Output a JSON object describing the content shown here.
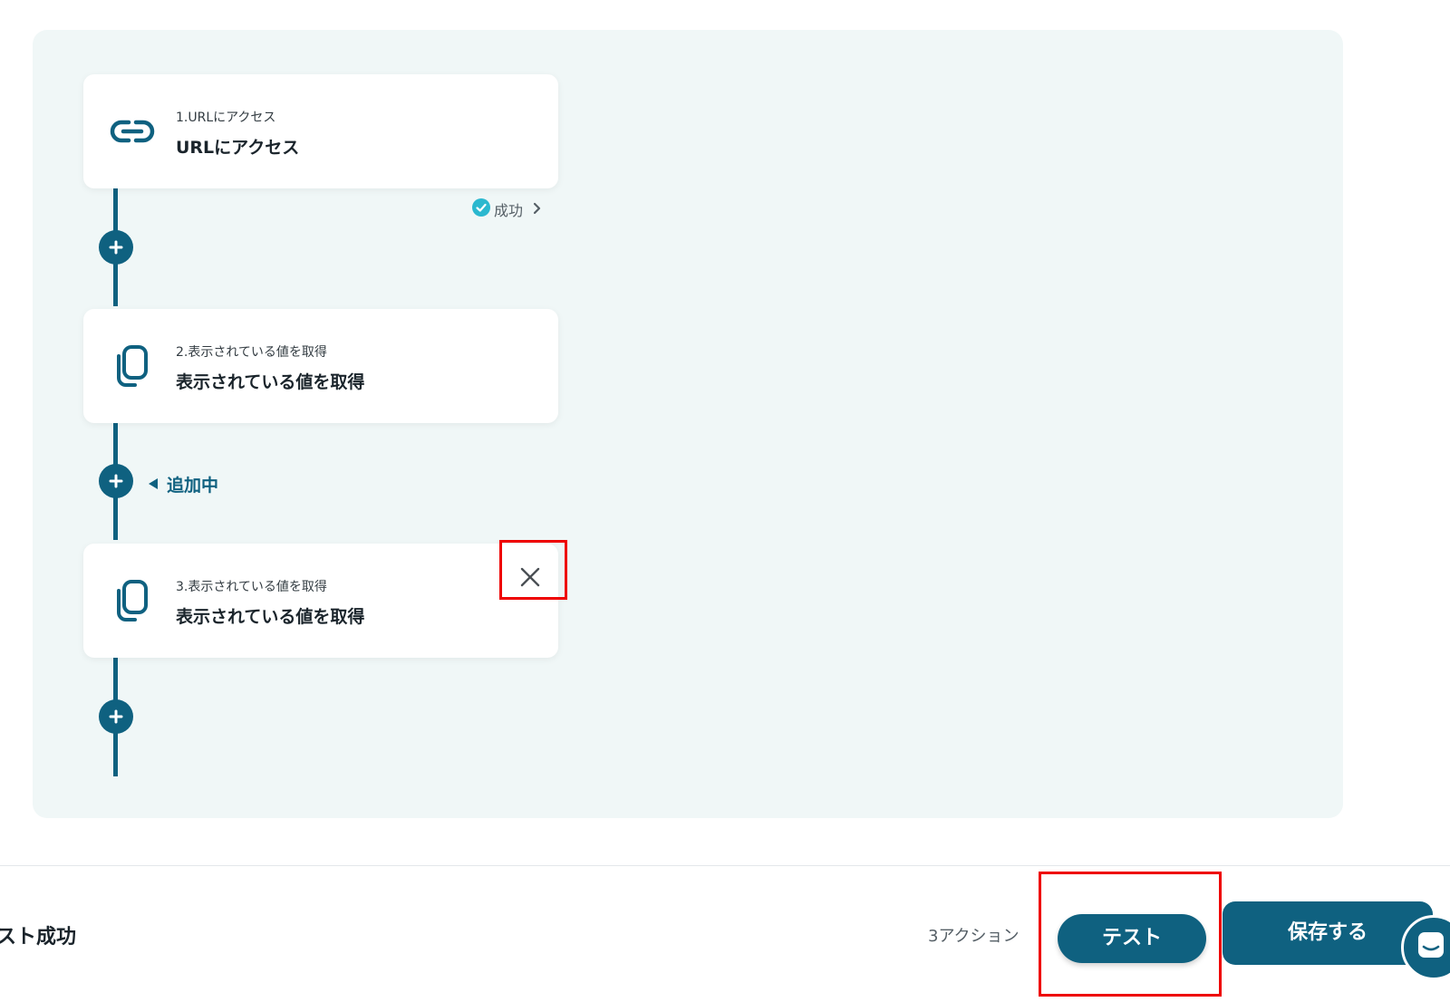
{
  "flow": {
    "steps": [
      {
        "index_label": "1.URLにアクセス",
        "title": "URLにアクセス",
        "icon": "link-icon"
      },
      {
        "index_label": "2.表示されている値を取得",
        "title": "表示されている値を取得",
        "icon": "copy-icon"
      },
      {
        "index_label": "3.表示されている値を取得",
        "title": "表示されている値を取得",
        "icon": "copy-icon"
      }
    ],
    "step1_status": "成功",
    "adding_label": "追加中"
  },
  "footer": {
    "status_text": "スト成功",
    "action_count": "3アクション",
    "test_label": "テスト",
    "save_label": "保存する"
  },
  "colors": {
    "accent": "#0f6180",
    "canvas_bg": "#f0f7f7",
    "success": "#2bb8cf",
    "highlight": "#ee0000"
  }
}
